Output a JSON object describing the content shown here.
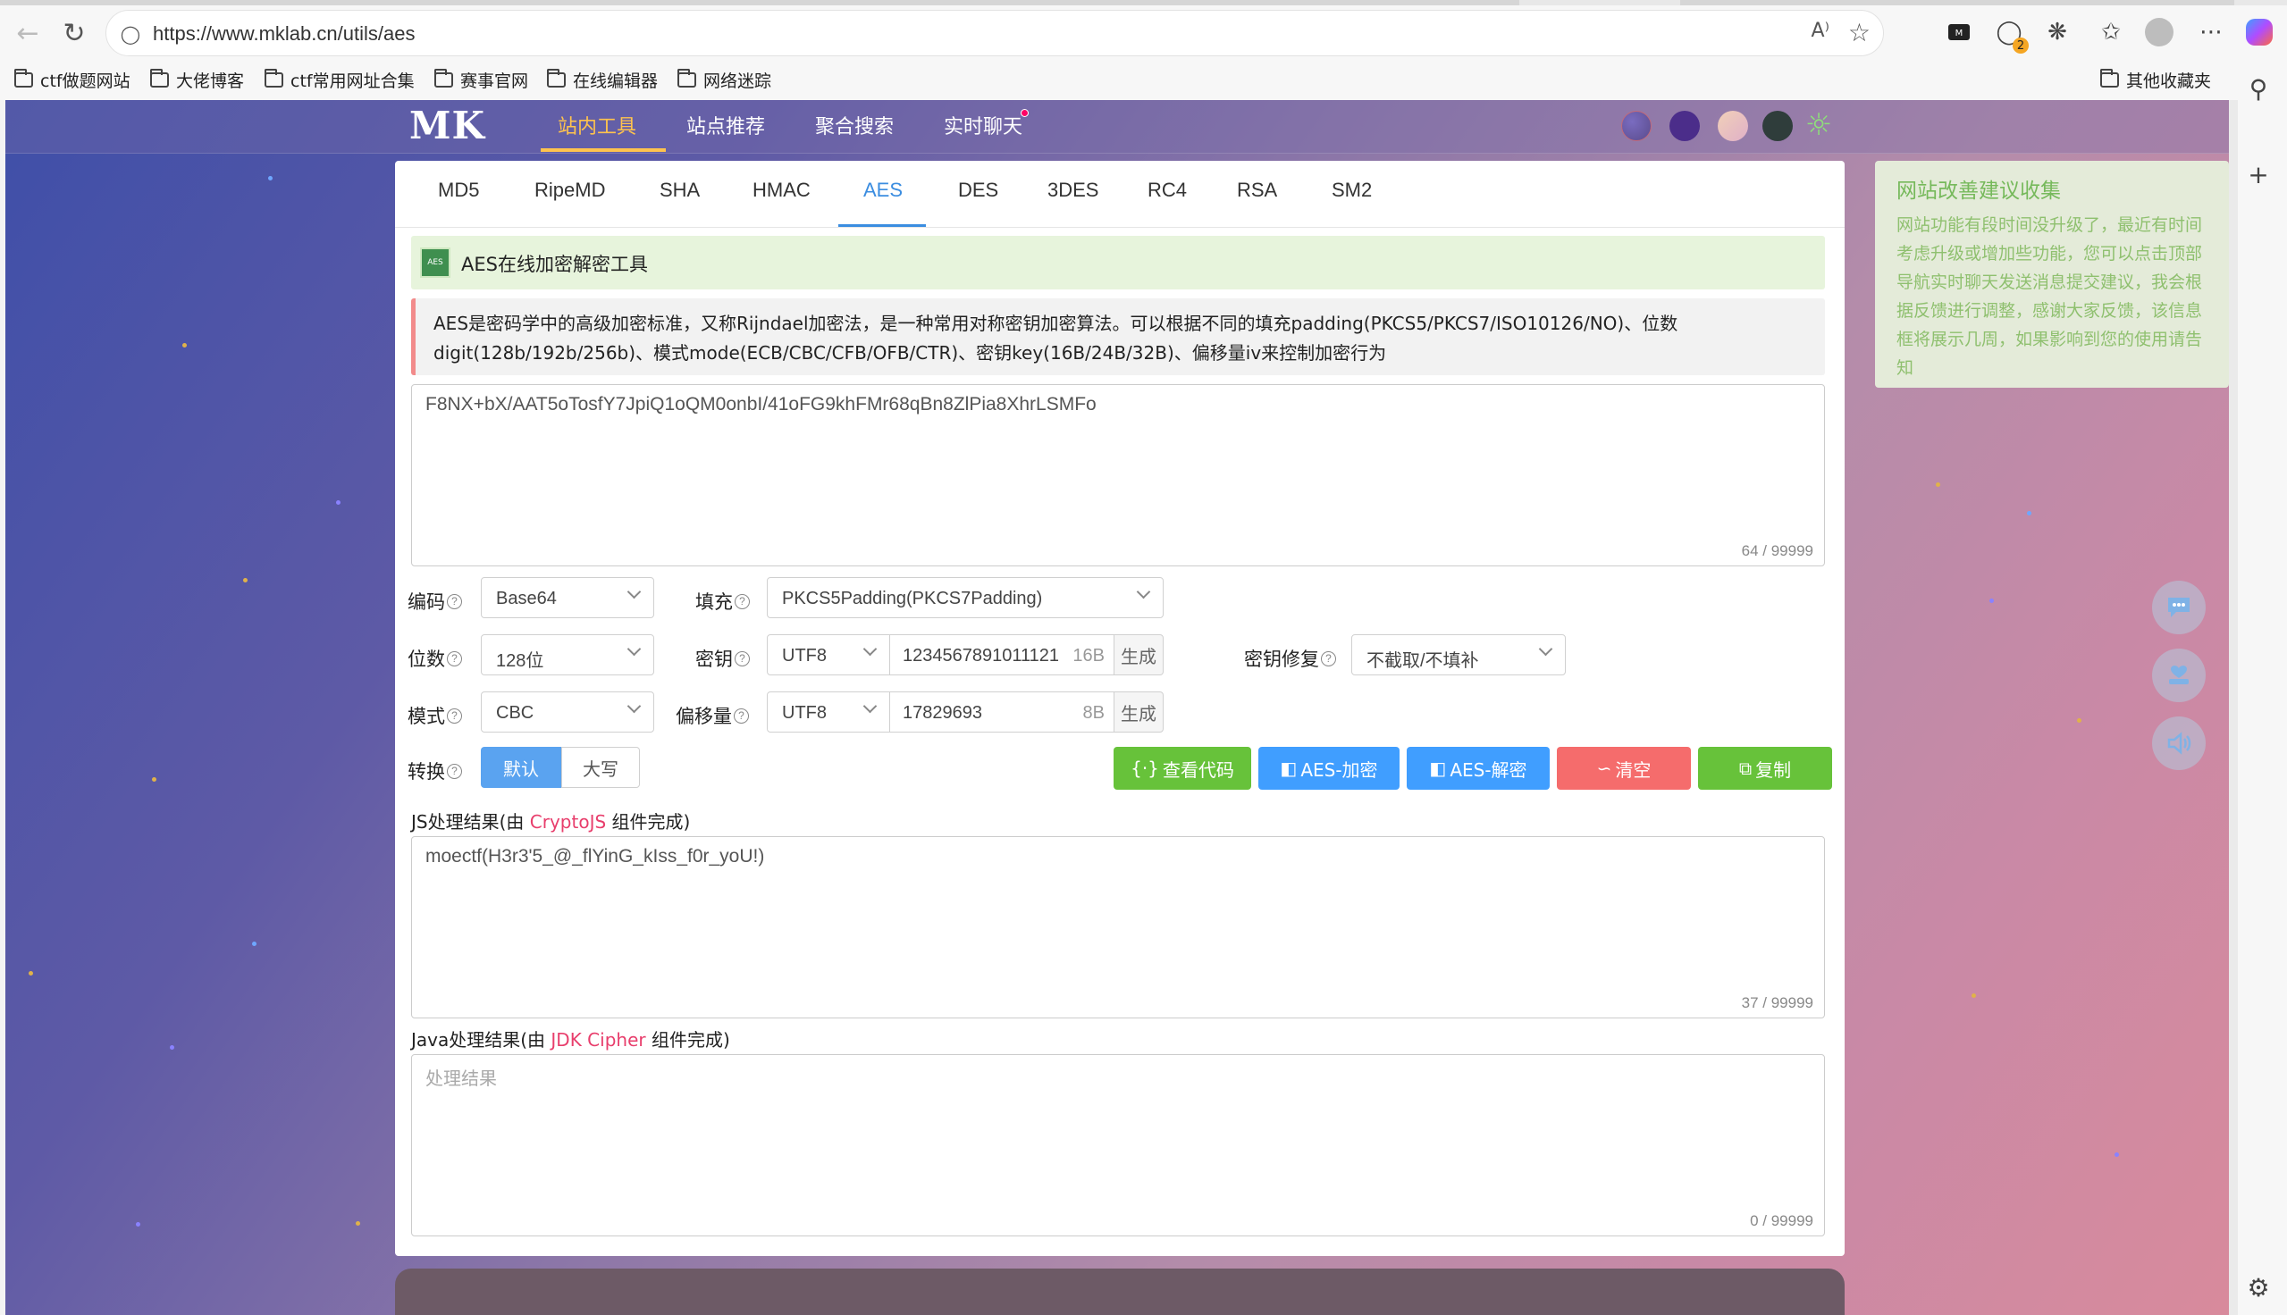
{
  "browser": {
    "url": "https://www.mklab.cn/utils/aes",
    "read_aloud_label": "A⁾",
    "ext_badge": "2",
    "bookmarks": [
      "ctf做题网站",
      "大佬博客",
      "ctf常用网址合集",
      "赛事官网",
      "在线编辑器",
      "网络迷踪"
    ],
    "other_bookmarks": "其他收藏夹"
  },
  "site": {
    "logo": "MK",
    "nav": [
      "站内工具",
      "站点推荐",
      "聚合搜索",
      "实时聊天"
    ],
    "theme_colors": [
      "#5a4b8c",
      "#4b2d8a",
      "#e9c3c6",
      "#2f3d3b"
    ]
  },
  "tool": {
    "tabs": [
      "MD5",
      "RipeMD",
      "SHA",
      "HMAC",
      "AES",
      "DES",
      "3DES",
      "RC4",
      "RSA",
      "SM2"
    ],
    "active_tab": "AES",
    "badge_text": "AES",
    "title": "AES在线加密解密工具",
    "description": "AES是密码学中的高级加密标准，又称Rijndael加密法，是一种常用对称密钥加密算法。可以根据不同的填充padding(PKCS5/PKCS7/ISO10126/NO)、位数digit(128b/192b/256b)、模式mode(ECB/CBC/CFB/OFB/CTR)、密钥key(16B/24B/32B)、偏移量iv来控制加密行为",
    "input_text": "F8NX+bX/AAT5oTosfY7JpiQ1oQM0onbI/41oFG9khFMr68qBn8ZlPia8XhrLSMFo",
    "input_count": "64 / 99999",
    "labels": {
      "encoding": "编码",
      "padding": "填充",
      "bits": "位数",
      "key": "密钥",
      "key_fix": "密钥修复",
      "mode": "模式",
      "iv": "偏移量",
      "convert": "转换"
    },
    "encoding_value": "Base64",
    "padding_value": "PKCS5Padding(PKCS7Padding)",
    "bits_value": "128位",
    "key_charset": "UTF8",
    "key_value": "1234567891011121",
    "key_size": "16B",
    "generate": "生成",
    "key_fix_value": "不截取/不填补",
    "mode_value": "CBC",
    "iv_charset": "UTF8",
    "iv_value": "17829693",
    "iv_size": "8B",
    "convert_options": [
      "默认",
      "大写"
    ],
    "buttons": {
      "view_code": "查看代码",
      "encrypt": "AES-加密",
      "decrypt": "AES-解密",
      "clear": "清空",
      "copy": "复制"
    },
    "js_result_prefix": "JS处理结果(由 ",
    "js_result_lib": "CryptoJS",
    "js_result_suffix": " 组件完成)",
    "js_result": "moectf(H3r3'5_@_flYinG_kIss_f0r_yoU!)",
    "js_count": "37 / 99999",
    "java_result_prefix": "Java处理结果(由 ",
    "java_result_lib": "JDK Cipher",
    "java_result_suffix": " 组件完成)",
    "java_placeholder": "处理结果",
    "java_count": "0 / 99999"
  },
  "feedback": {
    "title": "网站改善建议收集",
    "body": "网站功能有段时间没升级了，最近有时间考虑升级或增加些功能，您可以点击顶部导航实时聊天发送消息提交建议，我会根据反馈进行调整，感谢大家反馈，该信息框将展示几周，如果影响到您的使用请告知"
  },
  "colors": {
    "accent_blue": "#3b8de0",
    "nav_active": "#ffc34d",
    "btn_green": "#67c23a",
    "btn_blue": "#409eff",
    "btn_red": "#f56c6c"
  }
}
